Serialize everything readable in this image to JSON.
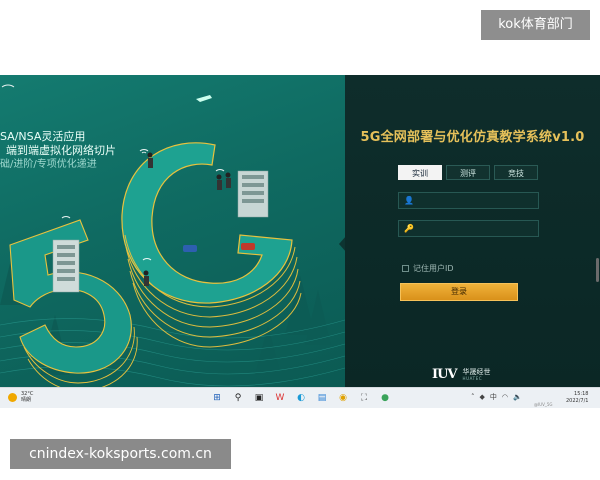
{
  "badges": {
    "top": "kok体育部门",
    "bottom": "cnindex-koksports.com.cn"
  },
  "hero": {
    "line1": "SA/NSA灵活应用",
    "line2": "端到端虚拟化网络切片",
    "line3": "础/进阶/专项优化递进",
    "big_text": "5G"
  },
  "login": {
    "title": "5G全网部署与优化仿真教学系统v1.0",
    "tabs": [
      {
        "label": "实训",
        "active": true
      },
      {
        "label": "测评",
        "active": false
      },
      {
        "label": "竞技",
        "active": false
      }
    ],
    "username": {
      "value": "",
      "placeholder": "",
      "icon": "user-icon"
    },
    "password": {
      "value": "",
      "placeholder": "",
      "icon": "lock-icon"
    },
    "remember_label": "记住用户ID",
    "button_label": "登录",
    "logo": {
      "mark": "IUV",
      "cn": "华晟经世",
      "en": "HUATEC"
    },
    "accent_color": "#e6c15a",
    "button_color": "#e8a12a"
  },
  "taskbar": {
    "weather_temp": "32°C",
    "weather_desc": "晴朗",
    "icons": [
      "windows-start-icon",
      "search-icon",
      "task-view-icon",
      "wps-icon",
      "edge-icon",
      "app-icon",
      "chrome-icon",
      "network-tool-icon",
      "app2-icon"
    ],
    "clock_time": "15:18",
    "clock_date": "2022/7/1",
    "tray_text": "中",
    "watermark": "@IUV_5G"
  }
}
